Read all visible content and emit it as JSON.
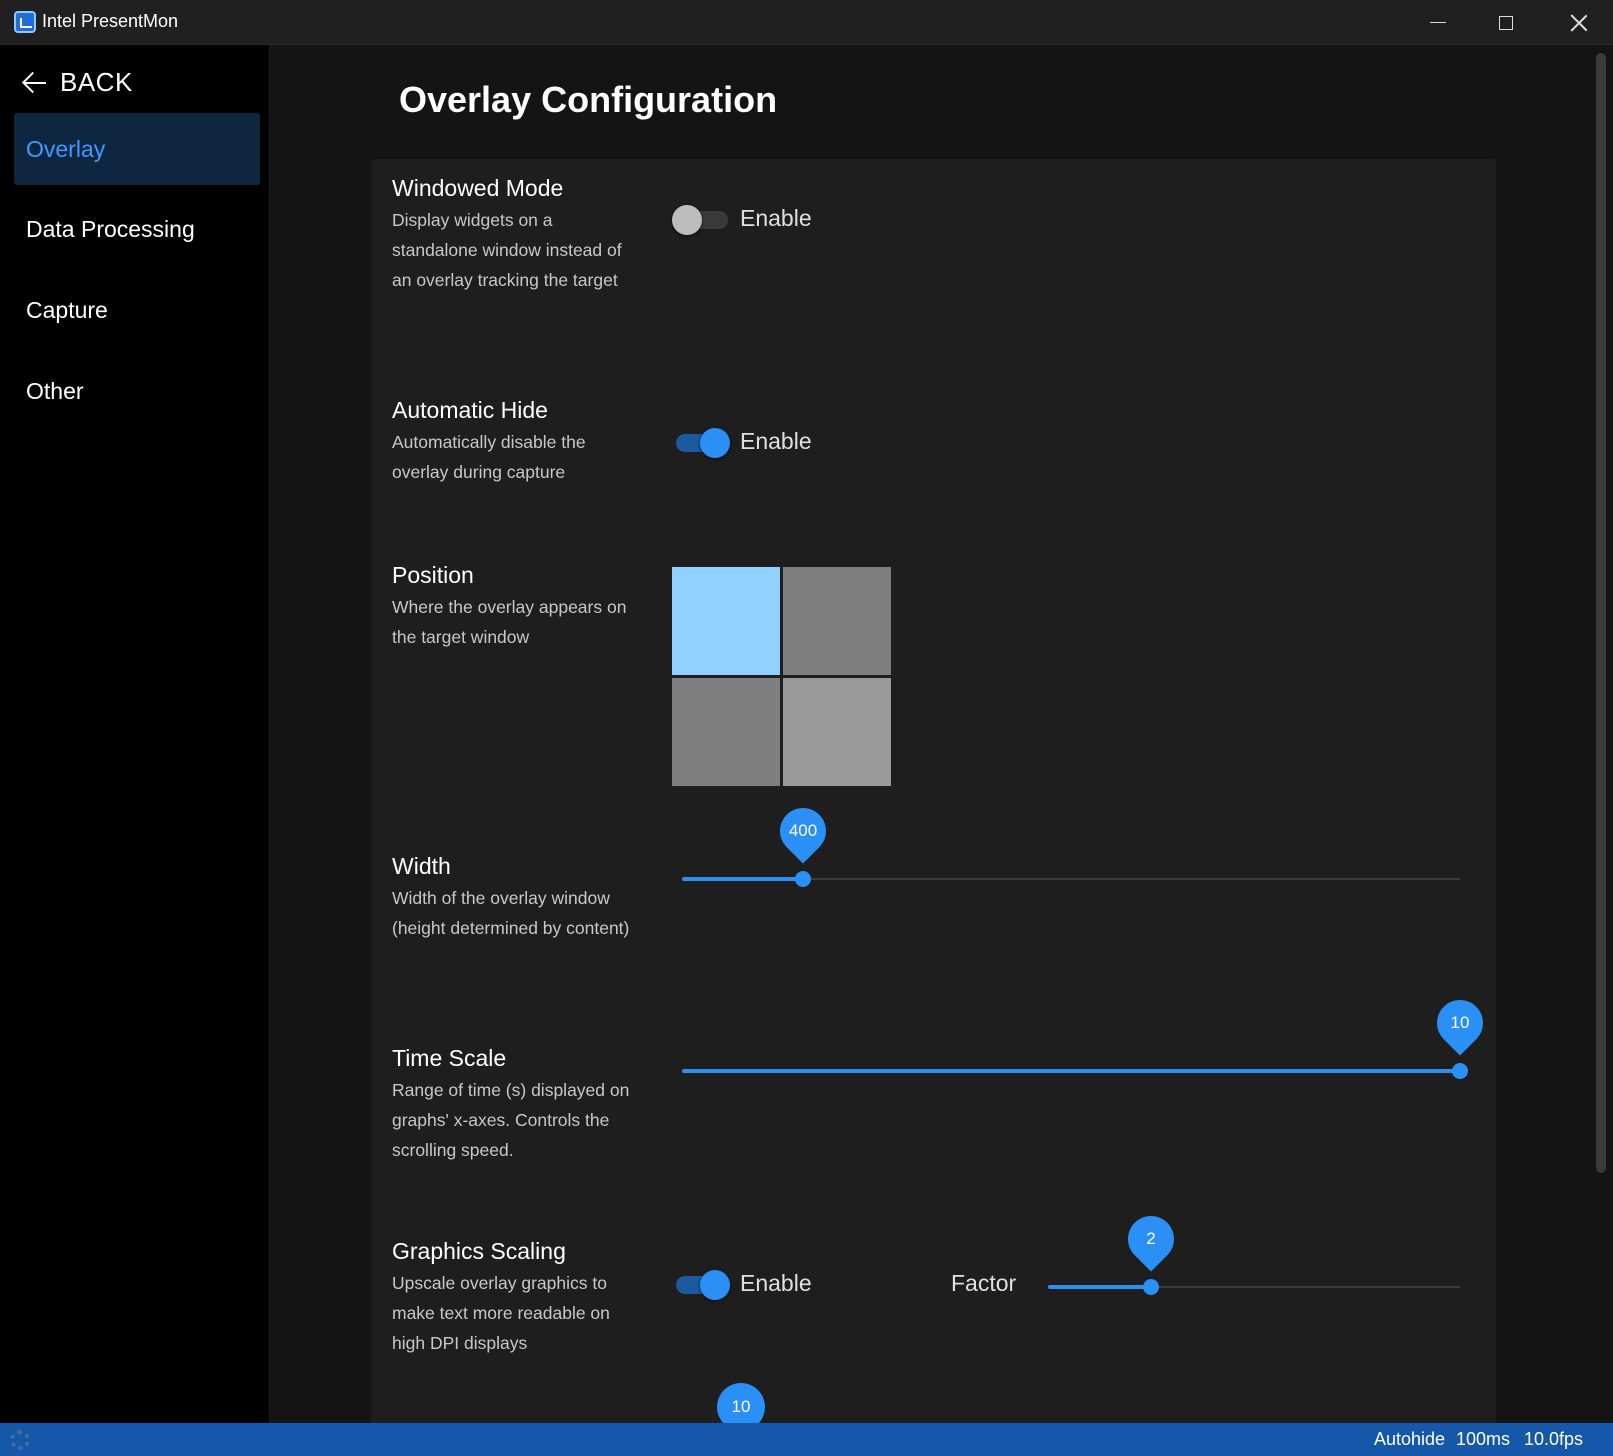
{
  "window": {
    "title": "Intel PresentMon"
  },
  "sidebar": {
    "back_label": "BACK",
    "items": [
      {
        "label": "Overlay",
        "active": true
      },
      {
        "label": "Data Processing",
        "active": false
      },
      {
        "label": "Capture",
        "active": false
      },
      {
        "label": "Other",
        "active": false
      }
    ]
  },
  "main": {
    "title": "Overlay Configuration",
    "sections": {
      "windowed_mode": {
        "title": "Windowed Mode",
        "description": "Display widgets on a standalone window instead of an overlay tracking the target",
        "toggle_label": "Enable",
        "enabled": false
      },
      "automatic_hide": {
        "title": "Automatic Hide",
        "description": "Automatically disable the overlay during capture",
        "toggle_label": "Enable",
        "enabled": true
      },
      "position": {
        "title": "Position",
        "description": "Where the overlay appears on the target window",
        "selected": "top-left",
        "colors": {
          "selected": "#8fd0ff",
          "normal": "#7f7f7f",
          "hover": "#9a9a9a"
        }
      },
      "width": {
        "title": "Width",
        "description": "Width of the overlay window (height determined by content)",
        "value": "400",
        "fraction": 0.155
      },
      "time_scale": {
        "title": "Time Scale",
        "description": "Range of time (s) displayed on graphs' x-axes. Controls the scrolling speed.",
        "value": "10",
        "fraction": 1.0
      },
      "graphics_scaling": {
        "title": "Graphics Scaling",
        "description": "Upscale overlay graphics to make text more readable on high DPI displays",
        "toggle_label": "Enable",
        "enabled": true,
        "factor_label": "Factor",
        "factor_value": "2",
        "factor_fraction": 0.25
      },
      "next_value": "10"
    }
  },
  "statusbar": {
    "autohide": "Autohide",
    "interval": "100ms",
    "fps": "10.0fps"
  },
  "colors": {
    "accent": "#2a90f5",
    "statusbar": "#1557a8",
    "active_nav_bg": "#0e2640"
  }
}
